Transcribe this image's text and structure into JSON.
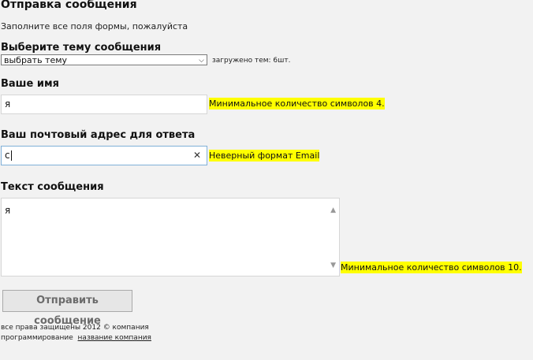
{
  "header": {
    "title": "Отправка сообщения",
    "subtitle": "Заполните все поля формы, пожалуйста"
  },
  "topic": {
    "label": "Выберите тему сообщения",
    "selected": "выбрать тему",
    "loaded_text": "загружено тем: 6шт."
  },
  "name": {
    "label": "Ваше имя",
    "value": "я",
    "error": "Минимальное количество символов 4."
  },
  "email": {
    "label": "Ваш почтовый адрес для ответа",
    "value": "c",
    "error": "Неверный формат Email"
  },
  "message": {
    "label": "Текст сообщения",
    "value": "я",
    "error": "Минимальное количество символов 10."
  },
  "submit": {
    "label": "Отправить сообщение"
  },
  "footer": {
    "line1": "все права защищены 2012 © компания",
    "line2": "программирование",
    "link": "название компания"
  },
  "colors": {
    "highlight": "#ffff00",
    "focus_border": "#7fb0d8"
  }
}
